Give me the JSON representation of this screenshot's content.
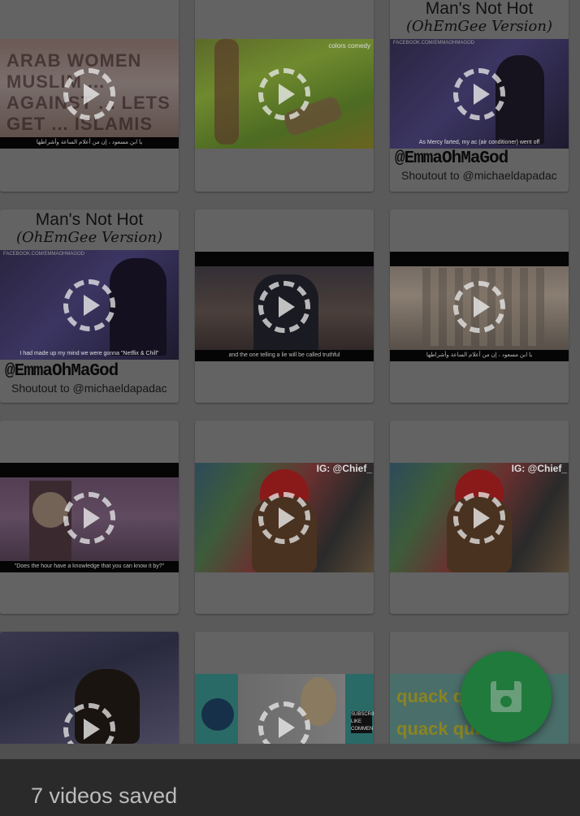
{
  "videos": [
    {
      "id": "v1",
      "caption": "يا ابن مسعود ، إن من أعلام الساعة وأشراطها",
      "overlay_text": "ARAB WOMEN MUSLIM ... AGAINST ... LETS GET ... ISLAMIS",
      "scene": "protest"
    },
    {
      "id": "v2",
      "caption": "",
      "overlay_text": "",
      "scene": "grass",
      "corner_text": "colors comedy"
    },
    {
      "id": "v3",
      "caption": "As Mercy farted, my ac (air conditioner) went off",
      "scene": "studio",
      "title": "Man's Not Hot",
      "subtitle": "(OhEmGee Version)",
      "handle": "@EmmaOhMaGod",
      "shoutout": "Shoutout to @michaeldapadac",
      "watermark": "FACEBOOK.COM/EMMAOHMAGOD"
    },
    {
      "id": "v4",
      "caption": "I had made up my mind we were gonna \"Netflix & Chill\"",
      "scene": "studio",
      "title": "Man's Not Hot",
      "subtitle": "(OhEmGee Version)",
      "handle": "@EmmaOhMaGod",
      "shoutout": "Shoutout to @michaeldapadac",
      "watermark": "FACEBOOK.COM/EMMAOHMAGOD"
    },
    {
      "id": "v5",
      "caption": "and the one telling a lie will be called truthful",
      "scene": "night"
    },
    {
      "id": "v6",
      "caption": "يا ابن مسعود ، إن من أعلام الساعة وأشراطها",
      "scene": "building"
    },
    {
      "id": "v7",
      "caption": "\"Does the hour have a knowledge that you can know it by?\"",
      "scene": "clock"
    },
    {
      "id": "v8",
      "caption": "",
      "scene": "selfie",
      "corner_text": "IG: @Chief_"
    },
    {
      "id": "v9",
      "caption": "",
      "scene": "selfie",
      "corner_text": "IG: @Chief_"
    },
    {
      "id": "v10",
      "caption": "",
      "scene": "car"
    },
    {
      "id": "v11",
      "caption": "",
      "scene": "teal",
      "side_text": "SUBSCRIBE LIKE COMMENT"
    },
    {
      "id": "v12",
      "caption": "",
      "scene": "quack",
      "overlay_text": "quack quack quack quack"
    }
  ],
  "fab": {
    "icon": "save-icon"
  },
  "snackbar": {
    "message": "7 videos saved"
  }
}
